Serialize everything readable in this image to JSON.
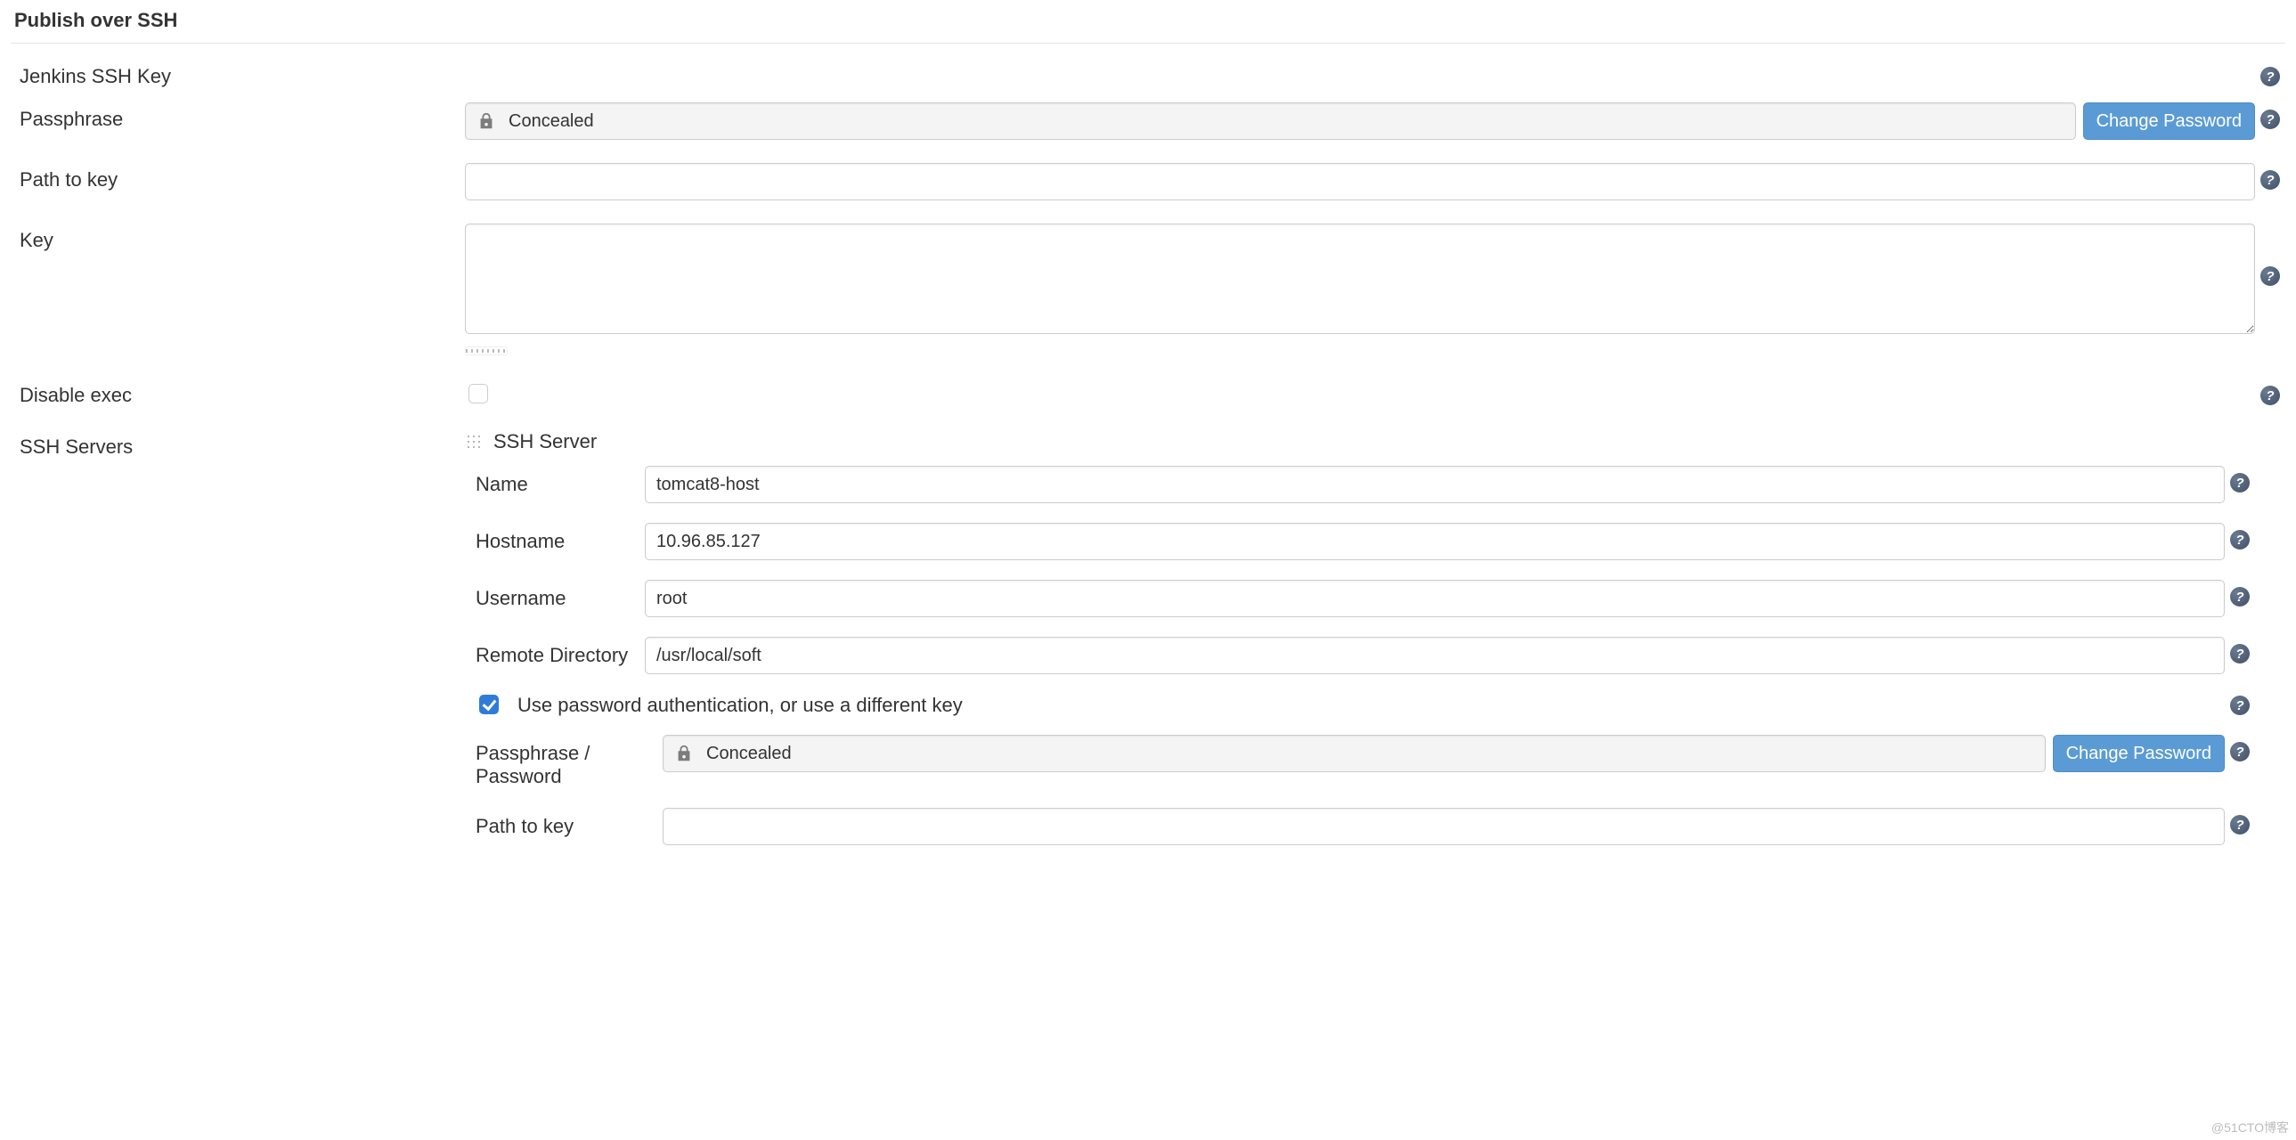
{
  "section_title": "Publish over SSH",
  "jenkins_ssh_key_heading": "Jenkins SSH Key",
  "passphrase": {
    "label": "Passphrase",
    "concealed_text": "Concealed",
    "change_button": "Change Password"
  },
  "path_to_key": {
    "label": "Path to key",
    "value": ""
  },
  "key": {
    "label": "Key",
    "value": ""
  },
  "disable_exec": {
    "label": "Disable exec",
    "checked": false
  },
  "ssh_servers": {
    "label": "SSH Servers",
    "server_heading": "SSH Server",
    "name": {
      "label": "Name",
      "value": "tomcat8-host"
    },
    "hostname": {
      "label": "Hostname",
      "value": "10.96.85.127"
    },
    "username": {
      "label": "Username",
      "value": "root"
    },
    "remote_directory": {
      "label": "Remote Directory",
      "value": "/usr/local/soft"
    },
    "use_password_auth": {
      "label": "Use password authentication, or use a different key",
      "checked": true
    },
    "pass_or_password": {
      "label": "Passphrase / Password",
      "concealed_text": "Concealed",
      "change_button": "Change Password"
    },
    "server_path_to_key": {
      "label": "Path to key",
      "value": ""
    }
  },
  "watermark": "@51CTO博客"
}
